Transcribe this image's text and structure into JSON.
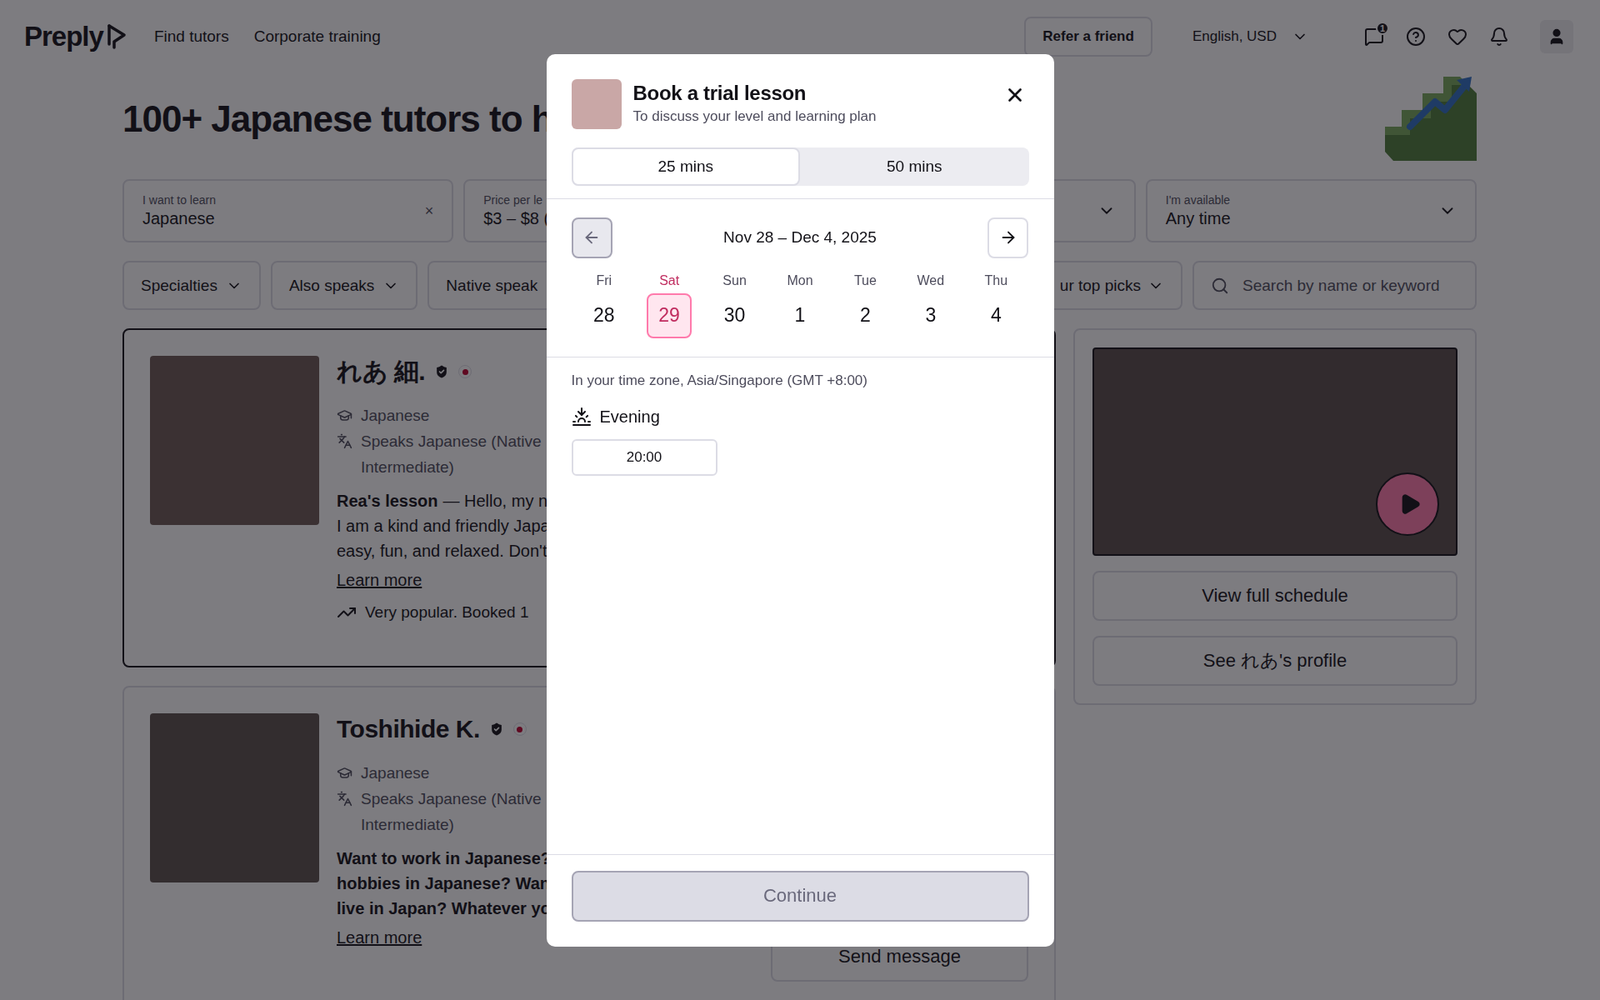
{
  "header": {
    "logo": "Preply",
    "nav": [
      {
        "label": "Find tutors"
      },
      {
        "label": "Corporate training"
      }
    ],
    "refer": "Refer a friend",
    "locale": "English, USD",
    "messages_badge": "1"
  },
  "page": {
    "title": "100+ Japanese tutors to help yo"
  },
  "filters": [
    {
      "label": "I want to learn",
      "value": "Japanese",
      "kind": "clearable",
      "clear": "×"
    },
    {
      "label": "Price per le",
      "value": "$3 – $8 (",
      "kind": "dropdown"
    },
    {
      "label": "",
      "value": "",
      "kind": "dropdown"
    },
    {
      "label": "I'm available",
      "value": "Any time",
      "kind": "dropdown"
    }
  ],
  "chips": [
    {
      "label": "Specialties"
    },
    {
      "label": "Also speaks"
    },
    {
      "label": "Native speak"
    }
  ],
  "sort": {
    "label": "ur top picks"
  },
  "search": {
    "placeholder": "Search by name or keyword"
  },
  "tutors": [
    {
      "kind": "lesson",
      "name": "れあ 細.",
      "subject": "Japanese",
      "speaks": [
        "Speaks Japanese (Native",
        "Intermediate)"
      ],
      "lesson_title": "Rea's lesson",
      "lines": [
        "— Hello, my na",
        "I am a kind and friendly Japa",
        "easy, fun, and relaxed. Don't"
      ],
      "learn_more": "Learn more",
      "popularity": "Very popular. Booked 1",
      "selected": true
    },
    {
      "kind": "headline",
      "name": "Toshihide K.",
      "subject": "Japanese",
      "speaks": [
        "Speaks Japanese (Native",
        "Intermediate)"
      ],
      "lines": [
        "Want to work in Japanese?",
        "hobbies in Japanese? Want",
        "live in Japan? Whatever you"
      ],
      "learn_more": "Learn more",
      "action": "Send message",
      "selected": false
    }
  ],
  "preview": {
    "schedule": "View full schedule",
    "profile": "See れあ's profile"
  },
  "modal": {
    "title": "Book a trial lesson",
    "subtitle": "To discuss your level and learning plan",
    "durations": [
      {
        "label": "25 mins",
        "selected": true
      },
      {
        "label": "50 mins",
        "selected": false
      }
    ],
    "week": {
      "range": "Nov 28 – Dec 4, 2025",
      "prev_disabled": true,
      "next_disabled": false
    },
    "days": [
      {
        "weekday": "Fri",
        "date": "28",
        "selected": false
      },
      {
        "weekday": "Sat",
        "date": "29",
        "selected": true
      },
      {
        "weekday": "Sun",
        "date": "30",
        "selected": false
      },
      {
        "weekday": "Mon",
        "date": "1",
        "selected": false
      },
      {
        "weekday": "Tue",
        "date": "2",
        "selected": false
      },
      {
        "weekday": "Wed",
        "date": "3",
        "selected": false
      },
      {
        "weekday": "Thu",
        "date": "4",
        "selected": false
      }
    ],
    "timezone": "In your time zone, Asia/Singapore (GMT +8:00)",
    "periods": [
      {
        "label": "Evening",
        "slots": [
          {
            "time": "20:00",
            "selected": false
          }
        ]
      }
    ],
    "continue": {
      "label": "Continue",
      "disabled": true
    }
  }
}
